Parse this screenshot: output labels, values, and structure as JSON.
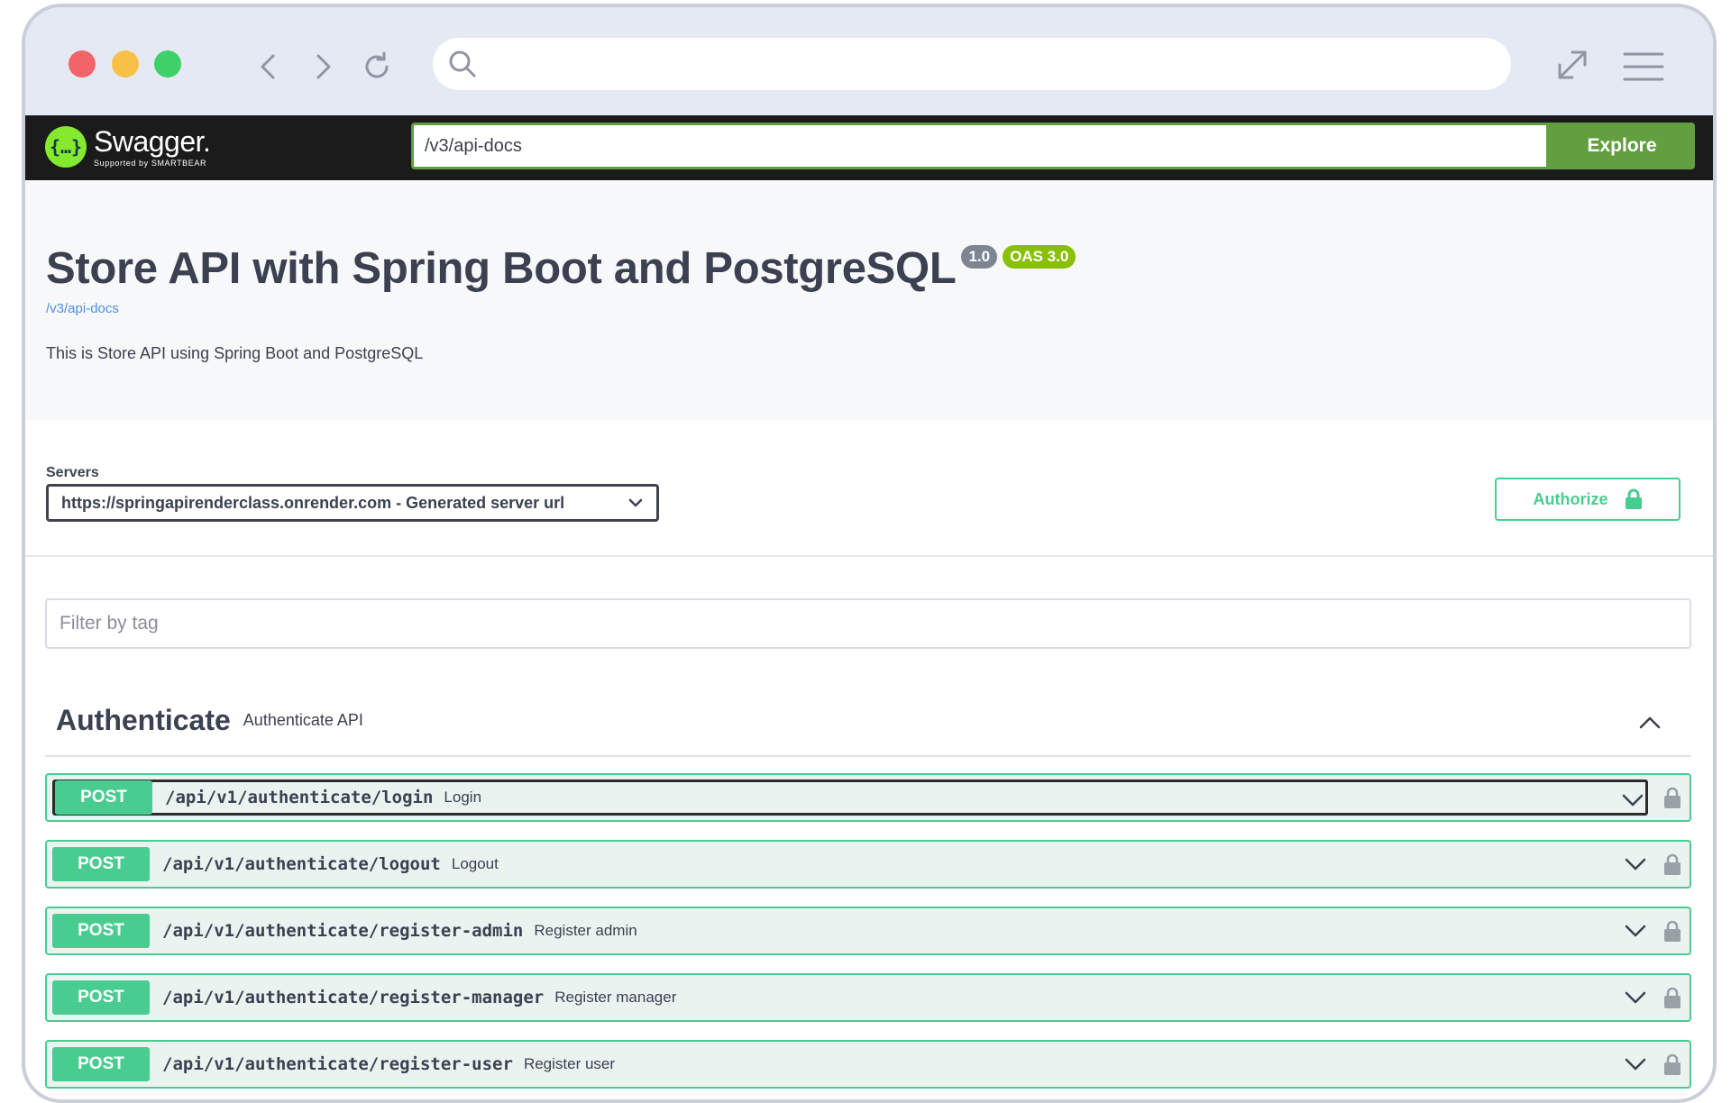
{
  "browser": {
    "url_value": ""
  },
  "topbar": {
    "logo_name": "Swagger.",
    "logo_sub": "Supported by SMARTBEAR",
    "spec_url": "/v3/api-docs",
    "explore_label": "Explore"
  },
  "info": {
    "title": "Store API with Spring Boot and PostgreSQL",
    "version": "1.0",
    "oas": "OAS 3.0",
    "link": "/v3/api-docs",
    "description": "This is Store API using Spring Boot and PostgreSQL"
  },
  "servers": {
    "label": "Servers",
    "selected": "https://springapirenderclass.onrender.com - Generated server url"
  },
  "authorize": {
    "label": "Authorize"
  },
  "filter": {
    "placeholder": "Filter by tag"
  },
  "tag": {
    "name": "Authenticate",
    "description": "Authenticate API"
  },
  "operations": [
    {
      "method": "POST",
      "path": "/api/v1/authenticate/login",
      "summary": "Login"
    },
    {
      "method": "POST",
      "path": "/api/v1/authenticate/logout",
      "summary": "Logout"
    },
    {
      "method": "POST",
      "path": "/api/v1/authenticate/register-admin",
      "summary": "Register admin"
    },
    {
      "method": "POST",
      "path": "/api/v1/authenticate/register-manager",
      "summary": "Register manager"
    },
    {
      "method": "POST",
      "path": "/api/v1/authenticate/register-user",
      "summary": "Register user"
    }
  ],
  "colors": {
    "post_green": "#49cc90",
    "swagger_green": "#62a03f",
    "topbar_bg": "#1b1b1b",
    "version_badge": "#7d8492",
    "oas_badge": "#89bf04",
    "link_blue": "#4990e2"
  },
  "icons": {
    "back": "chevron-left-icon",
    "forward": "chevron-right-icon",
    "reload": "reload-icon",
    "search": "search-icon",
    "expand": "expand-icon",
    "menu": "hamburger-menu-icon",
    "lock": "lock-icon",
    "chevron": "chevron-down-icon"
  }
}
